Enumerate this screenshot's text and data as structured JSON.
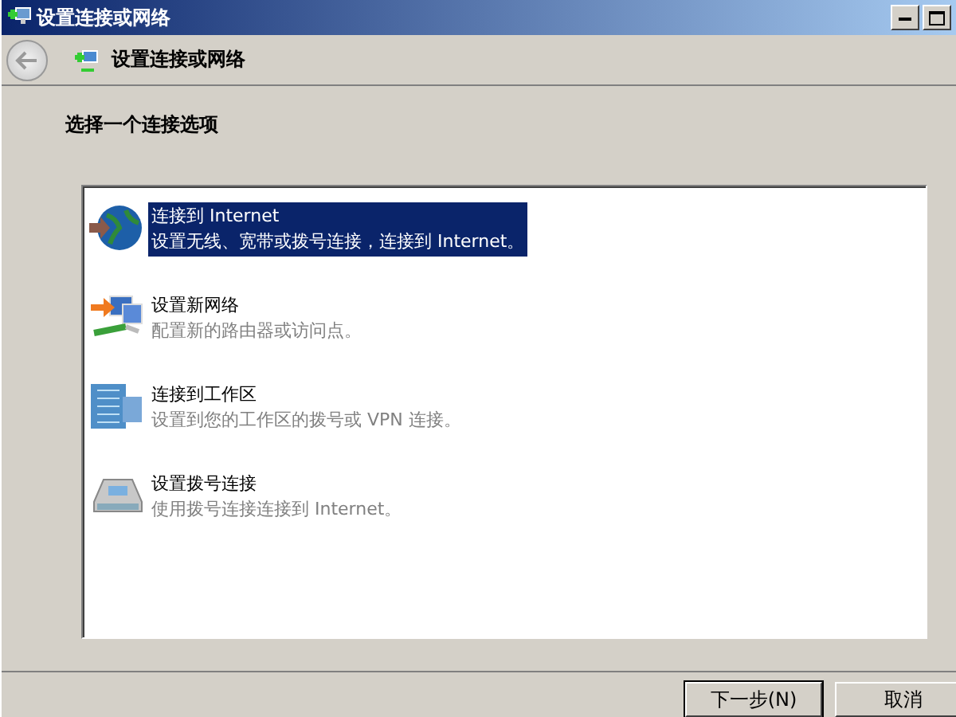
{
  "window": {
    "title": "设置连接或网络"
  },
  "nav": {
    "title": "设置连接或网络"
  },
  "heading": "选择一个连接选项",
  "options": [
    {
      "kind": "internet",
      "title": "连接到 Internet",
      "description": "设置无线、宽带或拨号连接，连接到 Internet。",
      "selected": true
    },
    {
      "kind": "network",
      "title": "设置新网络",
      "description": "配置新的路由器或访问点。",
      "selected": false
    },
    {
      "kind": "workplace",
      "title": "连接到工作区",
      "description": "设置到您的工作区的拨号或 VPN 连接。",
      "selected": false
    },
    {
      "kind": "dialup",
      "title": "设置拨号连接",
      "description": "使用拨号连接连接到 Internet。",
      "selected": false
    }
  ],
  "buttons": [
    "下一步(N)",
    "取消"
  ]
}
